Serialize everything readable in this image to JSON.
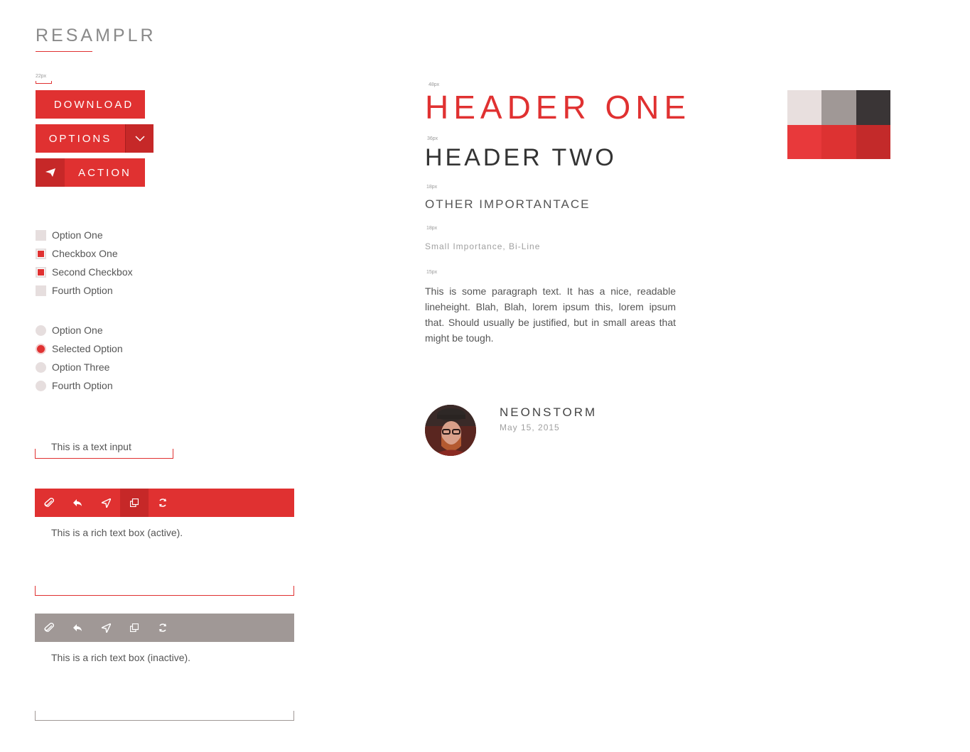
{
  "brand": {
    "logo": "RESAMPLR"
  },
  "sizes": {
    "button_label": "22px",
    "h1": "48px",
    "h2": "36px",
    "h3": "18px",
    "small": "18px",
    "paragraph": "15px"
  },
  "buttons": {
    "download": "DOWNLOAD",
    "options": "OPTIONS",
    "action": "ACTION",
    "options_icon": "chevron-down-icon",
    "action_icon": "paper-plane-icon"
  },
  "checkboxes": [
    {
      "label": "Option One",
      "checked": false
    },
    {
      "label": "Checkbox One",
      "checked": true
    },
    {
      "label": "Second Checkbox",
      "checked": true
    },
    {
      "label": "Fourth Option",
      "checked": false
    }
  ],
  "radios": [
    {
      "label": "Option One",
      "selected": false
    },
    {
      "label": "Selected Option",
      "selected": true
    },
    {
      "label": "Option Three",
      "selected": false
    },
    {
      "label": "Fourth Option",
      "selected": false
    }
  ],
  "text_input": {
    "value": "This is a text input"
  },
  "rich_text_active": {
    "text": "This is a rich text box (active).",
    "tools": [
      "paperclip-icon",
      "reply-icon",
      "navigation-icon",
      "copy-icon",
      "refresh-icon"
    ],
    "active_tool": "copy-icon"
  },
  "rich_text_inactive": {
    "text": "This is a rich text box (inactive).",
    "tools": [
      "paperclip-icon",
      "reply-icon",
      "navigation-icon",
      "copy-icon",
      "refresh-icon"
    ]
  },
  "typography": {
    "h1": "HEADER ONE",
    "h2": "HEADER TWO",
    "h3": "OTHER IMPORTANTACE",
    "small": "Small Importance, Bi-Line",
    "paragraph": "This is some paragraph text.  It has a nice, readable lineheight.  Blah, Blah, lorem ipsum this, lorem ipsum that.  Should usually be justified, but in small areas that might be tough."
  },
  "profile": {
    "name": "NEONSTORM",
    "date": "May 15, 2015"
  },
  "palette": [
    "#e8dfde",
    "#a09896",
    "#3a3536",
    "#e8393b",
    "#dd3232",
    "#c32a2a"
  ],
  "colors": {
    "accent": "#e03131",
    "accent_dark": "#c62828",
    "inactive": "#a09896"
  }
}
